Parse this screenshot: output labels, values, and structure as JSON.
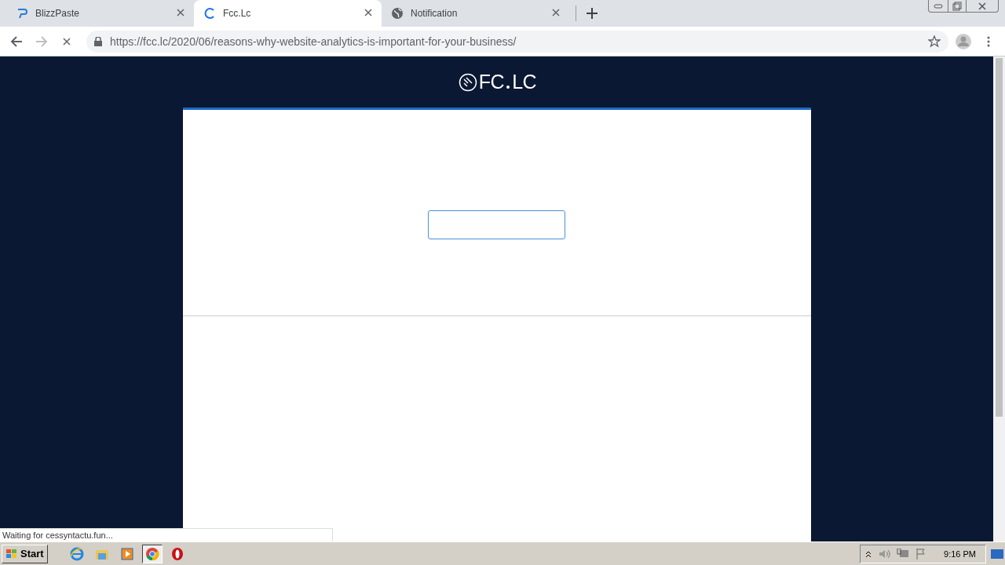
{
  "tabs": [
    {
      "title": "BlizzPaste",
      "kind": "brand",
      "selected": false
    },
    {
      "title": "Fcc.Lc",
      "kind": "loading",
      "selected": true
    },
    {
      "title": "Notification",
      "kind": "globe",
      "selected": false
    }
  ],
  "address_bar": {
    "url": "https://fcc.lc/2020/06/reasons-why-website-analytics-is-important-for-your-business/",
    "loading": true
  },
  "page": {
    "logo_left": "FC",
    "logo_right": "LC"
  },
  "status_bubble": "Waiting for cessyntactu.fun...",
  "taskbar": {
    "start": "Start",
    "apps": [
      {
        "kind": "ie",
        "selected": false
      },
      {
        "kind": "folder",
        "selected": false
      },
      {
        "kind": "media",
        "selected": false
      },
      {
        "kind": "chrome",
        "selected": true
      },
      {
        "kind": "opera",
        "selected": false
      }
    ],
    "clock": "9:16 PM"
  }
}
